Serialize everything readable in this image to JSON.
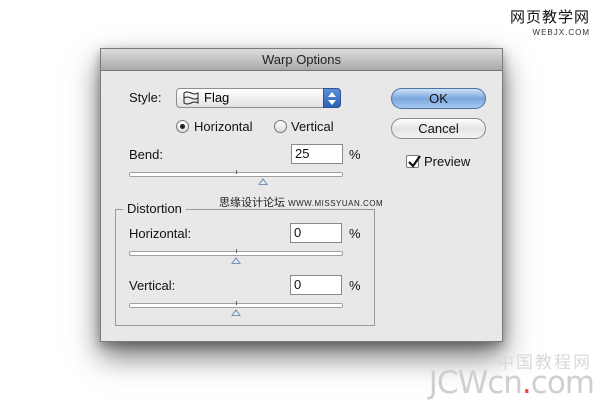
{
  "watermarks": {
    "top_cn": "网页教学网",
    "top_url": "WEBJX.COM",
    "mid_cn": "思缘设计论坛",
    "mid_url": "WWW.MISSYUAN.COM",
    "bottom_cn": "中国教程网",
    "bottom_logo_prefix": "JCWcn",
    "bottom_logo_dot": ".",
    "bottom_logo_suffix": "com"
  },
  "dialog": {
    "title": "Warp Options",
    "style_label": "Style:",
    "style_value": "Flag",
    "style_icon": "flag-warp-icon",
    "orientation": {
      "options": [
        "Horizontal",
        "Vertical"
      ],
      "selected": "Horizontal"
    },
    "bend": {
      "label": "Bend:",
      "value": "25",
      "unit": "%",
      "slider_value": 25
    },
    "distortion": {
      "title": "Distortion",
      "horizontal": {
        "label": "Horizontal:",
        "value": "0",
        "unit": "%",
        "slider_value": 0
      },
      "vertical": {
        "label": "Vertical:",
        "value": "0",
        "unit": "%",
        "slider_value": 0
      }
    },
    "buttons": {
      "ok": "OK",
      "cancel": "Cancel"
    },
    "preview": {
      "label": "Preview",
      "checked": true
    },
    "colors": {
      "accent": "#3f72c4",
      "dialog_bg": "#e8e8e8"
    }
  }
}
